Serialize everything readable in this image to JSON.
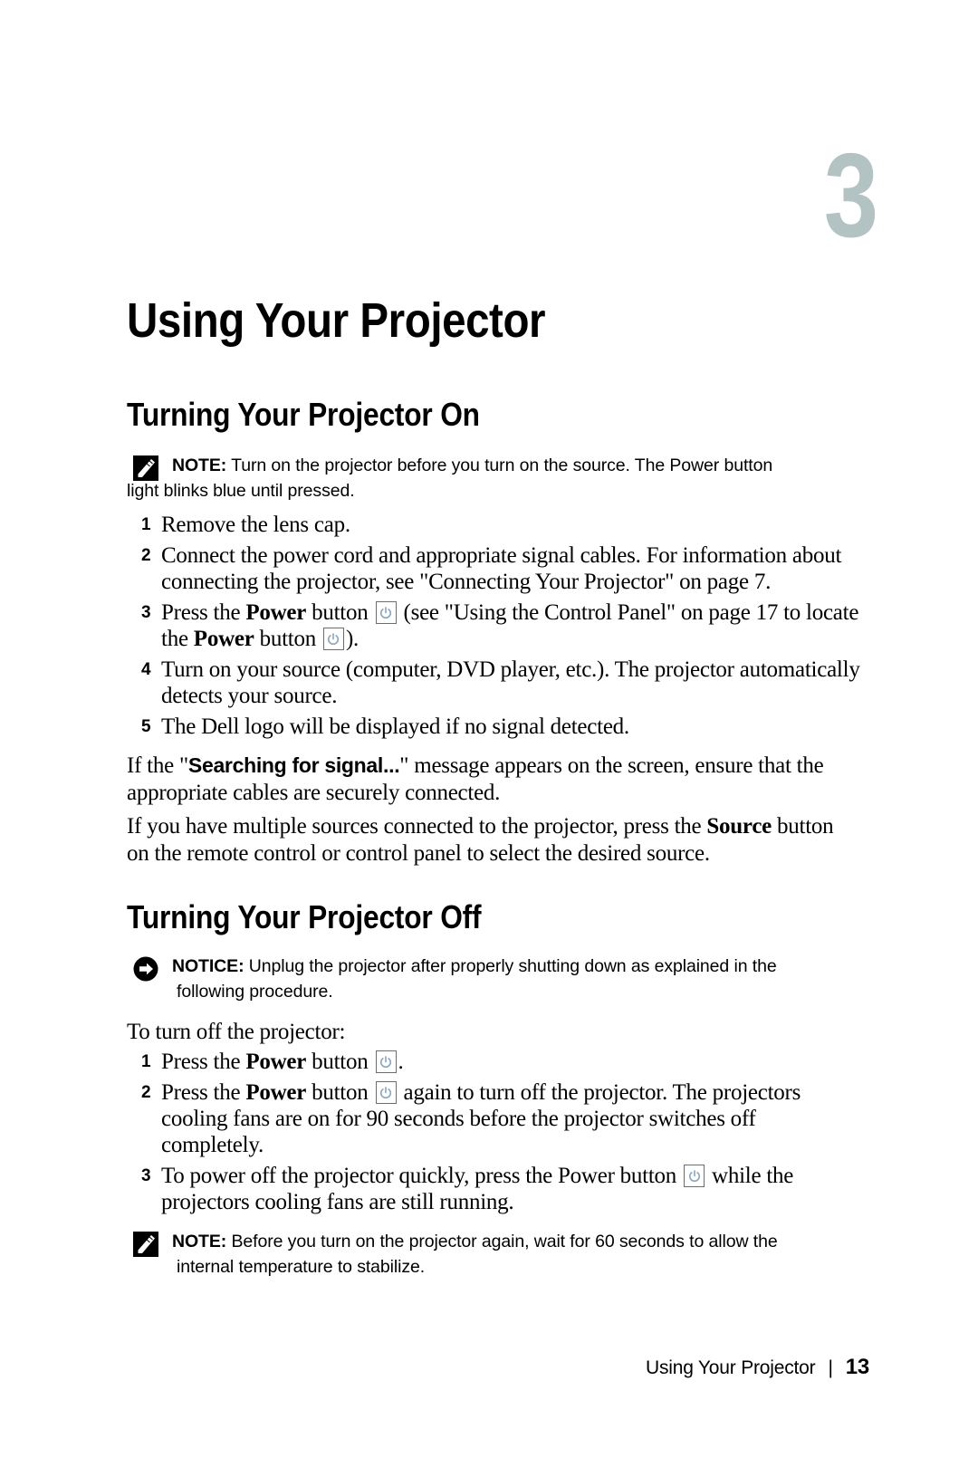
{
  "chapter": {
    "number": "3",
    "number_color": "#b3c2c2"
  },
  "page_title": "Using Your Projector",
  "sections": [
    {
      "id": "on",
      "heading": "Turning Your Projector On"
    },
    {
      "id": "off",
      "heading": "Turning Your Projector Off"
    }
  ],
  "note1": {
    "icon": "note-pencil-icon",
    "lead": "NOTE:",
    "text_line1": "Turn on the projector before you turn on the source. The Power button",
    "text_line2": "light blinks blue until pressed."
  },
  "list_on": [
    {
      "num": "1",
      "parts": [
        {
          "type": "text",
          "value": "Remove the lens cap."
        }
      ]
    },
    {
      "num": "2",
      "parts": [
        {
          "type": "text",
          "value": "Connect the power cord and appropriate signal cables. For information about connecting the projector, see \"Connecting Your Projector\" on page 7."
        }
      ]
    },
    {
      "num": "3",
      "parts": [
        {
          "type": "text",
          "value": "Press the "
        },
        {
          "type": "bold",
          "value": "Power"
        },
        {
          "type": "text",
          "value": " button "
        },
        {
          "type": "icon",
          "value": "power-button-icon"
        },
        {
          "type": "text",
          "value": " (see \"Using the Control Panel\" on page 17 to locate the "
        },
        {
          "type": "bold",
          "value": "Power"
        },
        {
          "type": "text",
          "value": " button "
        },
        {
          "type": "icon",
          "value": "power-button-icon"
        },
        {
          "type": "text",
          "value": ")."
        }
      ]
    },
    {
      "num": "4",
      "parts": [
        {
          "type": "text",
          "value": "Turn on your source (computer, DVD player, etc.). The projector automatically detects your source."
        }
      ]
    },
    {
      "num": "5",
      "parts": [
        {
          "type": "text",
          "value": "The Dell logo will be displayed if no signal detected."
        }
      ]
    }
  ],
  "paragraphs": {
    "searching_pre": "If the \"",
    "searching_bold": "Searching for signal...",
    "searching_post": "\" message appears on the screen, ensure that the appropriate cables are securely connected.",
    "multiple_pre": "If you have multiple sources connected to the projector, press the ",
    "multiple_bold": "Source",
    "multiple_post": " button on the remote control or control panel to select the desired source.",
    "to_turn_off": "To turn off the projector:"
  },
  "notice1": {
    "icon": "notice-arrow-icon",
    "lead": "NOTICE:",
    "text_line1": "Unplug the projector after properly shutting down as explained in the",
    "text_line2": "following procedure."
  },
  "list_off": [
    {
      "num": "1",
      "parts": [
        {
          "type": "text",
          "value": "Press the "
        },
        {
          "type": "bold",
          "value": "Power"
        },
        {
          "type": "text",
          "value": " button "
        },
        {
          "type": "icon",
          "value": "power-button-icon"
        },
        {
          "type": "text",
          "value": "."
        }
      ]
    },
    {
      "num": "2",
      "parts": [
        {
          "type": "text",
          "value": "Press the "
        },
        {
          "type": "bold",
          "value": "Power"
        },
        {
          "type": "text",
          "value": " button "
        },
        {
          "type": "icon",
          "value": "power-button-icon"
        },
        {
          "type": "text",
          "value": " again to turn off the projector. The projectors cooling fans are on for 90 seconds before the projector switches off completely."
        }
      ]
    },
    {
      "num": "3",
      "parts": [
        {
          "type": "text",
          "value": "To power off the projector quickly, press the Power button "
        },
        {
          "type": "icon",
          "value": "power-button-icon"
        },
        {
          "type": "text",
          "value": " while the projectors cooling fans are still running."
        }
      ]
    }
  ],
  "note2": {
    "icon": "note-pencil-icon",
    "lead": "NOTE:",
    "text_line1": "Before you turn on the projector again, wait for 60 seconds to allow the",
    "text_line2": "internal temperature to stabilize."
  },
  "footer": {
    "title": "Using Your Projector",
    "separator": "|",
    "page_number": "13"
  },
  "colors": {
    "chapter_number": "#b3c2c2",
    "power_icon": "#8fa8bf",
    "power_icon_border": "#6d6d6d",
    "text": "#000000"
  }
}
